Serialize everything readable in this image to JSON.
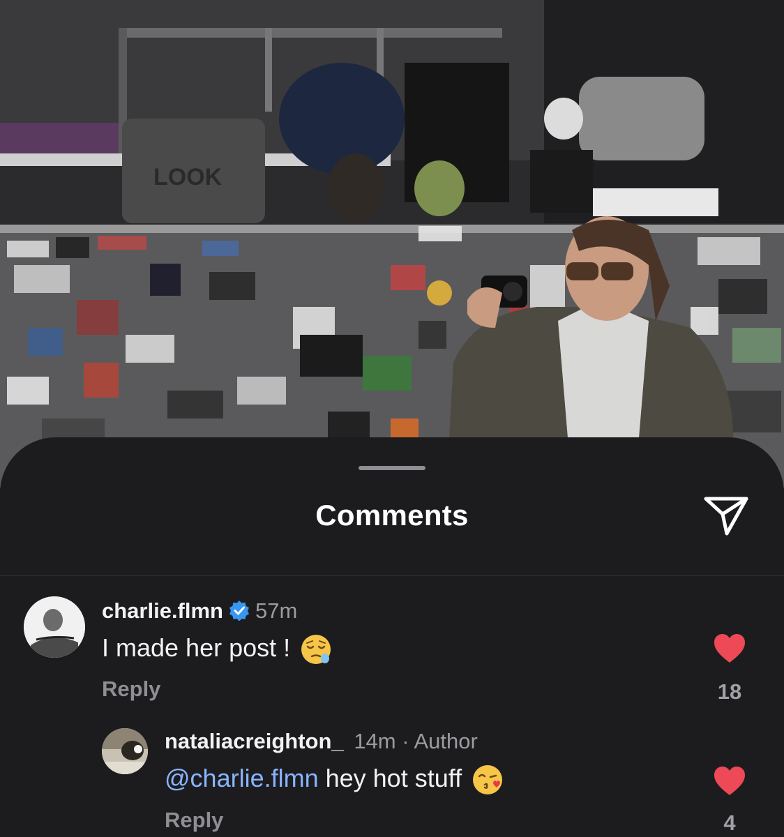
{
  "sheet": {
    "title": "Comments",
    "share_icon": "paper-plane-icon"
  },
  "comments": [
    {
      "username": "charlie.flmn",
      "verified": true,
      "time": "57m",
      "text": "I made her post !",
      "emoji": "sleepy-face-emoji",
      "reply_label": "Reply",
      "likes": "18",
      "liked": true,
      "like_color": "#ed4956"
    },
    {
      "username": "nataliacreighton_",
      "time": "14m",
      "separator": "·",
      "author_badge": "Author",
      "mention": "@charlie.flmn",
      "text": " hey hot stuff",
      "emoji": "face-blowing-kiss-emoji",
      "reply_label": "Reply",
      "likes": "4",
      "liked": true,
      "like_color": "#ed4956"
    }
  ],
  "colors": {
    "sheet_background": "#1c1c1e",
    "mention": "#8ab4ff",
    "verified_badge": "#3897f0"
  }
}
